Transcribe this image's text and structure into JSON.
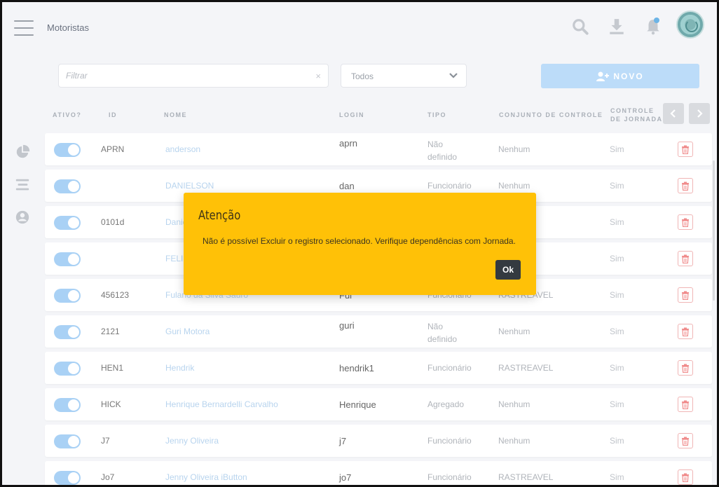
{
  "header": {
    "title": "Motoristas",
    "icons": [
      "menu-icon",
      "search-icon",
      "download-icon",
      "bell-icon",
      "avatar"
    ]
  },
  "filters": {
    "search_placeholder": "Filtrar",
    "clear_symbol": "×",
    "status_selected": "Todos",
    "new_button_label": "NOVO"
  },
  "table": {
    "columns": {
      "ativo": "ATIVO?",
      "id": "ID",
      "nome": "NOME",
      "login": "LOGIN",
      "tipo": "TIPO",
      "conjunto": "CONJUNTO DE CONTROLE",
      "controle_l1": "CONTROLE",
      "controle_l2": "DE JORNADA"
    },
    "rows": [
      {
        "id": "APRN",
        "nome": "anderson",
        "login": "aprn",
        "tipo_l1": "Não",
        "tipo_l2": "definido",
        "conjunto": "Nenhum",
        "controle": "Sim"
      },
      {
        "id": "",
        "nome": "DANIELSON",
        "login": "dan",
        "tipo_l1": "Funcionário",
        "tipo_l2": "",
        "conjunto": "Nenhum",
        "controle": "Sim"
      },
      {
        "id": "0101d",
        "nome": "Danie",
        "login": "",
        "tipo_l1": "",
        "tipo_l2": "",
        "conjunto": "",
        "controle": "Sim"
      },
      {
        "id": "",
        "nome": "FELIP",
        "login": "",
        "tipo_l1": "",
        "tipo_l2": "",
        "conjunto": "",
        "controle": "Sim"
      },
      {
        "id": "456123",
        "nome": "Fulano da Silva Sauro",
        "login": "Ful",
        "tipo_l1": "Funcionário",
        "tipo_l2": "",
        "conjunto": "RASTREAVEL",
        "controle": "Sim"
      },
      {
        "id": "2121",
        "nome": "Guri Motora",
        "login": "guri",
        "tipo_l1": "Não",
        "tipo_l2": "definido",
        "conjunto": "Nenhum",
        "controle": "Sim"
      },
      {
        "id": "HEN1",
        "nome": "Hendrik",
        "login": "hendrik1",
        "tipo_l1": "Funcionário",
        "tipo_l2": "",
        "conjunto": "RASTREAVEL",
        "controle": "Sim"
      },
      {
        "id": "HICK",
        "nome": "Henrique Bernardelli Carvalho",
        "login": "Henrique",
        "tipo_l1": "Agregado",
        "tipo_l2": "",
        "conjunto": "Nenhum",
        "controle": "Sim"
      },
      {
        "id": "J7",
        "nome": "Jenny Oliveira",
        "login": "j7",
        "tipo_l1": "Funcionário",
        "tipo_l2": "",
        "conjunto": "Nenhum",
        "controle": "Sim"
      },
      {
        "id": "Jo7",
        "nome": "Jenny Oliveira iButton",
        "login": "jo7",
        "tipo_l1": "Funcionário",
        "tipo_l2": "",
        "conjunto": "RASTREAVEL",
        "controle": "Sim"
      }
    ]
  },
  "modal": {
    "title": "Atenção",
    "message": "Não é possível Excluir o registro selecionado. Verifique dependências com Jornada.",
    "ok_label": "Ok"
  },
  "colors": {
    "modal_bg": "#ffc107",
    "accent_blue": "#bcdcf9",
    "toggle_on": "#a9d1f5",
    "ok_button": "#343a40"
  }
}
